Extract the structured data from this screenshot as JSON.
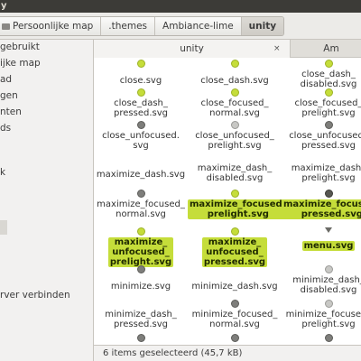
{
  "window": {
    "title": "y"
  },
  "breadcrumb": {
    "items": [
      {
        "label": "Persoonlijke map"
      },
      {
        "label": ".themes"
      },
      {
        "label": "Ambiance-lime"
      },
      {
        "label": "unity"
      }
    ]
  },
  "sidebar": {
    "items": [
      {
        "label": "gebruikt"
      },
      {
        "label": "ijke map"
      },
      {
        "label": "ad"
      },
      {
        "label": "gen"
      },
      {
        "label": "nten"
      },
      {
        "label": "ds"
      },
      {
        "label": "k"
      },
      {
        "label": "rver verbinden"
      }
    ]
  },
  "tabs": [
    {
      "label": "unity",
      "close": "×"
    },
    {
      "label": "Am"
    }
  ],
  "files": [
    {
      "name": "close.svg",
      "icon": "green"
    },
    {
      "name": "close_dash.svg",
      "icon": "green"
    },
    {
      "name": "close_dash_\ndisabled.svg",
      "icon": "green"
    },
    {
      "name": "close_dash_\npressed.svg",
      "icon": "green"
    },
    {
      "name": "close_focused_\nnormal.svg",
      "icon": "green"
    },
    {
      "name": "close_focused_\nprelight.svg",
      "icon": "green"
    },
    {
      "name": "close_unfocused.\nsvg",
      "icon": "gray"
    },
    {
      "name": "close_unfocused_\nprelight.svg",
      "icon": "lightgray"
    },
    {
      "name": "close_unfocused_\npressed.svg",
      "icon": "gray"
    },
    {
      "name": "maximize_dash.svg",
      "icon": "none"
    },
    {
      "name": "maximize_dash_\ndisabled.svg",
      "icon": "none"
    },
    {
      "name": "maximize_dash_\nprelight.svg",
      "icon": "none"
    },
    {
      "name": "maximize_focused_\nnormal.svg",
      "icon": "gray"
    },
    {
      "name": "maximize_focused_\nprelight.svg",
      "icon": "green",
      "selected": true
    },
    {
      "name": "maximize_focused_\npressed.svg",
      "icon": "dark",
      "selected": true
    },
    {
      "name": "maximize_\nunfocused_\nprelight.svg",
      "icon": "green",
      "selected": true
    },
    {
      "name": "maximize_\nunfocused_\npressed.svg",
      "icon": "green",
      "selected": true
    },
    {
      "name": "menu.svg",
      "icon": "tri",
      "selected": true
    },
    {
      "name": "minimize.svg",
      "icon": "gray"
    },
    {
      "name": "minimize_dash.svg",
      "icon": "none"
    },
    {
      "name": "minimize_dash_\ndisabled.svg",
      "icon": "lightgray"
    },
    {
      "name": "minimize_dash_\npressed.svg",
      "icon": "none"
    },
    {
      "name": "minimize_focused_\nnormal.svg",
      "icon": "gray"
    },
    {
      "name": "minimize_focused_\nprelight.svg",
      "icon": "lightgray"
    },
    {
      "name": "",
      "icon": "gray"
    },
    {
      "name": "",
      "icon": "gray"
    },
    {
      "name": "",
      "icon": "gray"
    }
  ],
  "status": {
    "text": "6 items geselecteerd (45,7 kB)"
  },
  "colors": {
    "selection": "#c5dd3a",
    "titlebar": "#3c3b37"
  }
}
